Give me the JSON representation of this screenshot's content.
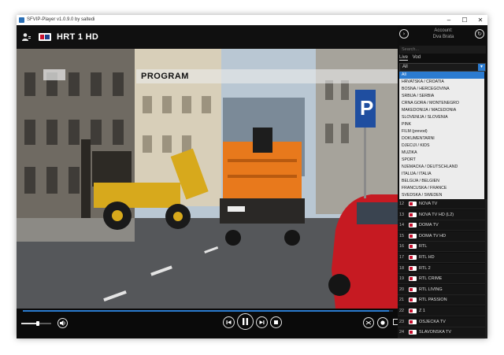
{
  "window": {
    "title": "SFVIP-Player v1.0.9.0 by saltedi",
    "controls": {
      "minimize": "–",
      "maximize": "☐",
      "close": "✕"
    }
  },
  "topbar": {
    "channel_name": "HRT 1 HD",
    "user_icon": "user-menu-icon",
    "channel_logo": "channel-logo-icon"
  },
  "video": {
    "overlay_text": "PROGRAM"
  },
  "controls": {
    "volume_level": 0.55,
    "progress": 0.99
  },
  "sidebar": {
    "account_label": "Account:",
    "account_name": "Dva Brata",
    "search_placeholder": "Search...",
    "tabs": [
      {
        "label": "Live",
        "active": true
      },
      {
        "label": "Vod",
        "active": false
      }
    ],
    "group_selected": "All",
    "group_options": [
      "All",
      "HRVATSKA / CROATIA",
      "BOSNA / HERCEGOVINA",
      "SRBIJA / SERBIA",
      "CRNA GORA / MONTENEGRO",
      "MAKEDONIJA / MACEDONIA",
      "SLOVENIJA / SLOVENIA",
      "PINK",
      "FILM (prevod)",
      "DOKUMENTARNI",
      "DJECIJI / KIDS",
      "MUZIKA",
      "SPORT",
      "NJEMACKA / DEUTSCHLAND",
      "ITALIJA / ITALIA",
      "BELGIJA / BELGIEN",
      "FRANCUSKA / FRANCE",
      "SVEDSKA / SWEDEN"
    ],
    "channels": [
      {
        "num": "12",
        "name": "NOVA TV"
      },
      {
        "num": "13",
        "name": "NOVA TV HD (L2)"
      },
      {
        "num": "14",
        "name": "DOMA TV"
      },
      {
        "num": "15",
        "name": "DOMA TV HD"
      },
      {
        "num": "16",
        "name": "RTL"
      },
      {
        "num": "17",
        "name": "RTL HD"
      },
      {
        "num": "18",
        "name": "RTL 2"
      },
      {
        "num": "19",
        "name": "RTL CRIME"
      },
      {
        "num": "20",
        "name": "RTL LIVING"
      },
      {
        "num": "21",
        "name": "RTL PASSION"
      },
      {
        "num": "22",
        "name": "Z 1"
      },
      {
        "num": "23",
        "name": "OSJECKA TV"
      },
      {
        "num": "24",
        "name": "SLAVONSKA TV"
      }
    ]
  },
  "colors": {
    "accent": "#2b7bd0",
    "background": "#0b0b0b"
  }
}
